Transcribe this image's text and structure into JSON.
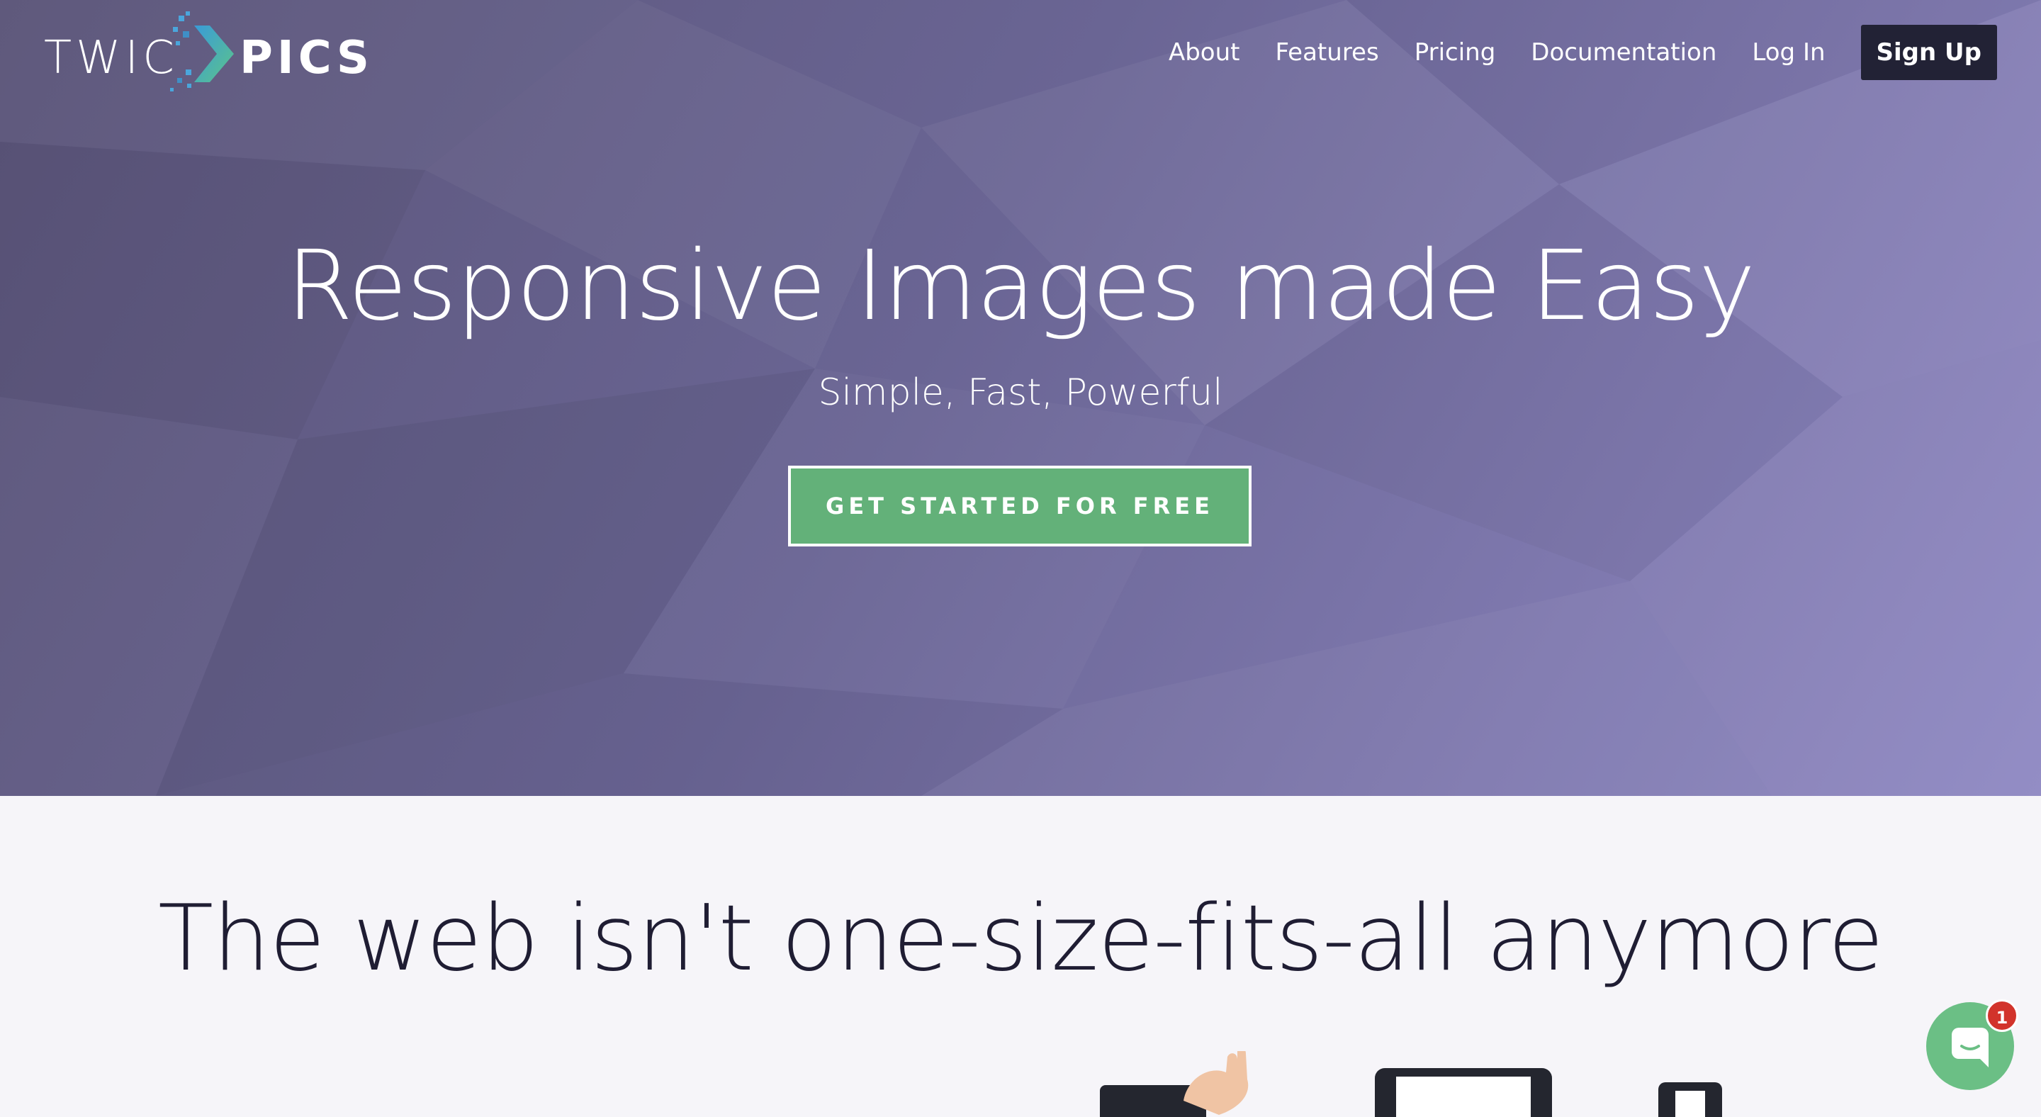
{
  "brand": {
    "part1": "TWIC",
    "part2": "PICS"
  },
  "nav": {
    "links": [
      "About",
      "Features",
      "Pricing",
      "Documentation",
      "Log In"
    ],
    "signup": "Sign Up"
  },
  "hero": {
    "title": "Responsive Images made Easy",
    "subtitle": "Simple, Fast, Powerful",
    "cta": "GET STARTED FOR FREE"
  },
  "section2": {
    "title": "The web isn't one-size-fits-all anymore"
  },
  "chat": {
    "badge": "1"
  },
  "colors": {
    "hero_start": "#5a5478",
    "hero_end": "#8e87c2",
    "cta_green": "#63b179",
    "signup_dark": "#222235",
    "chat_green": "#6bbf85",
    "badge_red": "#d2332b",
    "heading_dark": "#1f1d33"
  },
  "icons": {
    "logo_mark": "chevron-pixel-icon",
    "chat": "chat-bubble-icon"
  }
}
